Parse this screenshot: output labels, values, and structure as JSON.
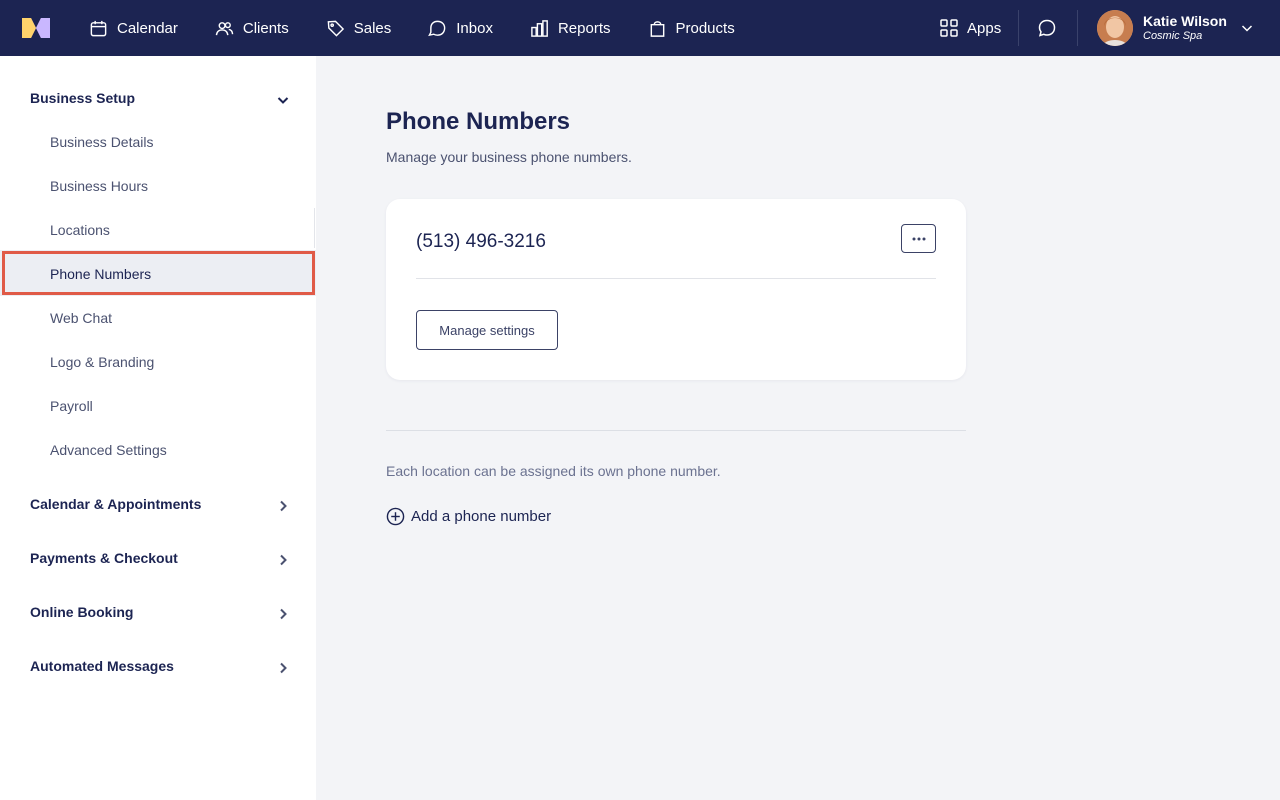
{
  "topbar": {
    "nav": [
      {
        "label": "Calendar",
        "icon": "calendar-icon"
      },
      {
        "label": "Clients",
        "icon": "clients-icon"
      },
      {
        "label": "Sales",
        "icon": "tag-icon"
      },
      {
        "label": "Inbox",
        "icon": "inbox-icon"
      },
      {
        "label": "Reports",
        "icon": "reports-icon"
      },
      {
        "label": "Products",
        "icon": "bag-icon"
      }
    ],
    "apps_label": "Apps",
    "user": {
      "name": "Katie Wilson",
      "org": "Cosmic Spa"
    }
  },
  "sidebar": {
    "sections": [
      {
        "label": "Business Setup",
        "expanded": true
      },
      {
        "label": "Calendar & Appointments",
        "expanded": false
      },
      {
        "label": "Payments & Checkout",
        "expanded": false
      },
      {
        "label": "Online Booking",
        "expanded": false
      },
      {
        "label": "Automated Messages",
        "expanded": false
      }
    ],
    "items": [
      "Business Details",
      "Business Hours",
      "Locations",
      "Phone Numbers",
      "Web Chat",
      "Logo & Branding",
      "Payroll",
      "Advanced Settings"
    ],
    "active_item": "Phone Numbers"
  },
  "main": {
    "title": "Phone Numbers",
    "subtitle": "Manage your business phone numbers.",
    "card": {
      "phone": "(513) 496-3216",
      "manage_label": "Manage settings"
    },
    "info": "Each location can be assigned its own phone number.",
    "add_label": "Add a phone number"
  },
  "colors": {
    "navy": "#1c2452",
    "highlight": "#e05a47",
    "page_bg": "#f3f4f7",
    "active_bg": "#eceef3"
  }
}
